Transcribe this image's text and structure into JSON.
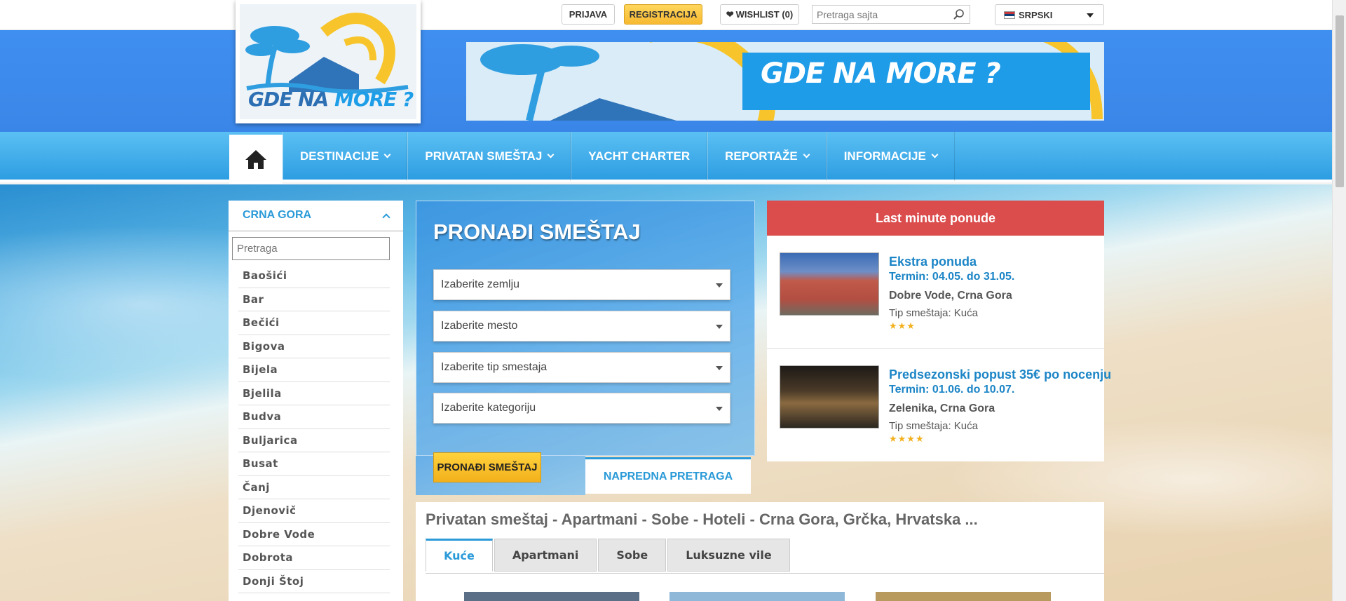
{
  "topbar": {
    "login_label": "PRIJAVA",
    "register_label": "REGISTRACIJA",
    "wishlist_label": "WISHLIST (0)",
    "search_placeholder": "Pretraga sajta",
    "language": "SRPSKI"
  },
  "logo": {
    "text_a": "GDE NA ",
    "text_b": "MORE ?"
  },
  "banner": {
    "text": "GDE NA MORE ?"
  },
  "nav": {
    "items": [
      {
        "label": "DESTINACIJE",
        "dropdown": true
      },
      {
        "label": "PRIVATAN SMEŠTAJ",
        "dropdown": true
      },
      {
        "label": "YACHT CHARTER",
        "dropdown": false
      },
      {
        "label": "REPORTAŽE",
        "dropdown": true
      },
      {
        "label": "INFORMACIJE",
        "dropdown": true
      }
    ]
  },
  "sidebar": {
    "heading": "CRNA GORA",
    "search_placeholder": "Pretraga",
    "items": [
      "Baošići",
      "Bar",
      "Bečići",
      "Bigova",
      "Bijela",
      "Bjelila",
      "Budva",
      "Buljarica",
      "Busat",
      "Čanj",
      "Djenovič",
      "Dobre Vode",
      "Dobrota",
      "Donji Štoj"
    ]
  },
  "search_panel": {
    "title": "PRONAĐI SMEŠTAJ",
    "selects": [
      "Izaberite zemlju",
      "Izaberite mesto",
      "Izaberite tip smestaja",
      "Izaberite kategoriju"
    ],
    "find_label": "PRONAĐI SMEŠTAJ",
    "advanced_label": "NAPREDNA PRETRAGA"
  },
  "last_minute": {
    "heading": "Last minute ponude",
    "offers": [
      {
        "title": "Ekstra ponuda",
        "date": "Termin: 04.05. do 31.05.",
        "location": "Dobre Vode, Crna Gora",
        "type": "Tip smeštaja: Kuća",
        "stars": "★★★"
      },
      {
        "title": "Predsezonski popust 35€ po nocenju",
        "date": "Termin: 01.06. do 10.07.",
        "location": "Zelenika, Crna Gora",
        "type": "Tip smeštaja: Kuća",
        "stars": "★★★★"
      }
    ]
  },
  "main": {
    "title": "Privatan smeštaj - Apartmani - Sobe - Hoteli - Crna Gora, Grčka, Hrvatska ...",
    "tabs": [
      "Kuće",
      "Apartmani",
      "Sobe",
      "Luksuzne vile"
    ]
  },
  "colors": {
    "accent": "#2a9ad8",
    "lastminute_header": "#db4c4c",
    "button_yellow": "#f7b931",
    "nav": "#3aa8ea"
  }
}
